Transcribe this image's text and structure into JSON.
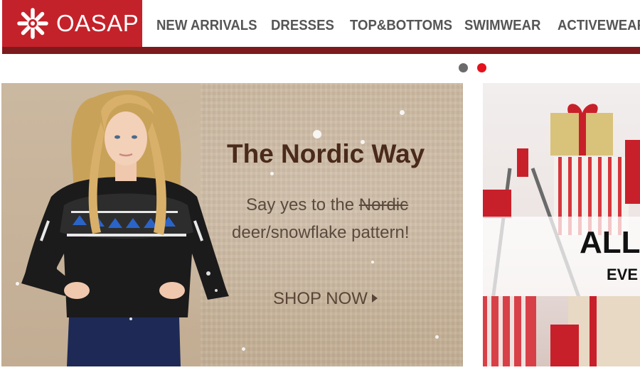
{
  "brand": {
    "name": "OASAP",
    "color": "#c4222a",
    "bar_color": "#7d1a1e"
  },
  "nav": {
    "items": [
      "NEW ARRIVALS",
      "DRESSES",
      "TOP&BOTTOMS",
      "SWIMWEAR",
      "ACTIVEWEAR"
    ]
  },
  "carousel": {
    "slide_count": 2,
    "active_slide": 2,
    "dot_colors": [
      "#6b6b6b",
      "#e4121c"
    ]
  },
  "main_banner": {
    "title": "The Nordic Way",
    "subtitle_prefix": "Say yes to the ",
    "subtitle_struck": "Nordic",
    "subtitle_line2": "deer/snowflake pattern!",
    "cta": "SHOP NOW",
    "cta_icon": "play-arrow-icon"
  },
  "side_banner": {
    "headline": "ALL U",
    "subline": "EVE"
  }
}
